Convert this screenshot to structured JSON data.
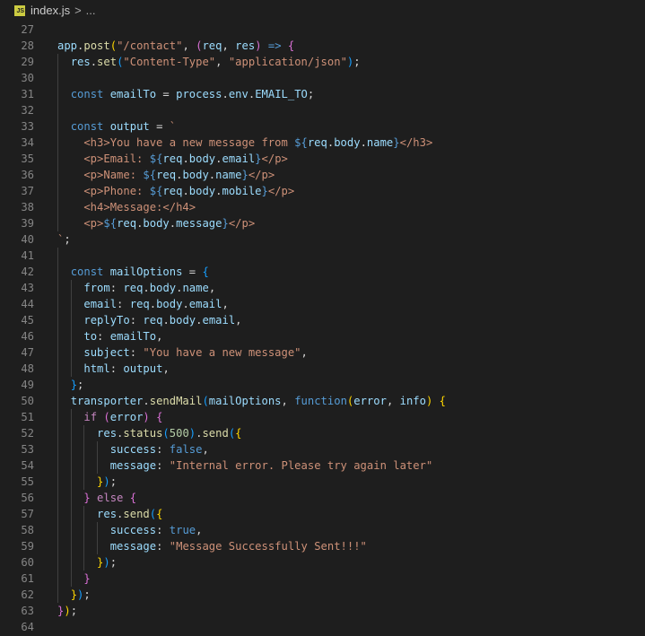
{
  "breadcrumb": {
    "file_icon": "JS",
    "file_name": "index.js",
    "separator": ">",
    "more": "..."
  },
  "colors": {
    "background": "#1e1e1e",
    "line_number": "#858585",
    "variable": "#9cdcfe",
    "function": "#dcdcaa",
    "string": "#ce9178",
    "keyword": "#569cd6",
    "control": "#c586c0",
    "bracket_1": "#ffd700",
    "bracket_2": "#da70d6",
    "bracket_3": "#179fff"
  },
  "lines": [
    {
      "num": "27",
      "tokens": []
    },
    {
      "num": "28",
      "tokens": [
        [
          "v",
          "app"
        ],
        [
          "p",
          "."
        ],
        [
          "f",
          "post"
        ],
        [
          "b1",
          "("
        ],
        [
          "s",
          "\"/contact\""
        ],
        [
          "p",
          ", "
        ],
        [
          "b2",
          "("
        ],
        [
          "v",
          "req"
        ],
        [
          "p",
          ", "
        ],
        [
          "v",
          "res"
        ],
        [
          "b2",
          ")"
        ],
        [
          "p",
          " "
        ],
        [
          "k",
          "=>"
        ],
        [
          "p",
          " "
        ],
        [
          "b2",
          "{"
        ]
      ]
    },
    {
      "num": "29",
      "tokens": [
        [
          "w",
          "  "
        ],
        [
          "v",
          "res"
        ],
        [
          "p",
          "."
        ],
        [
          "f",
          "set"
        ],
        [
          "b3",
          "("
        ],
        [
          "s",
          "\"Content-Type\""
        ],
        [
          "p",
          ", "
        ],
        [
          "s",
          "\"application/json\""
        ],
        [
          "b3",
          ")"
        ],
        [
          "p",
          ";"
        ]
      ]
    },
    {
      "num": "30",
      "tokens": []
    },
    {
      "num": "31",
      "tokens": [
        [
          "w",
          "  "
        ],
        [
          "k",
          "const"
        ],
        [
          "p",
          " "
        ],
        [
          "v",
          "emailTo"
        ],
        [
          "p",
          " = "
        ],
        [
          "v",
          "process"
        ],
        [
          "p",
          "."
        ],
        [
          "v",
          "env"
        ],
        [
          "p",
          "."
        ],
        [
          "v",
          "EMAIL_TO"
        ],
        [
          "p",
          ";"
        ]
      ]
    },
    {
      "num": "32",
      "tokens": []
    },
    {
      "num": "33",
      "tokens": [
        [
          "w",
          "  "
        ],
        [
          "k",
          "const"
        ],
        [
          "p",
          " "
        ],
        [
          "v",
          "output"
        ],
        [
          "p",
          " = "
        ],
        [
          "s",
          "`"
        ]
      ]
    },
    {
      "num": "34",
      "tokens": [
        [
          "s",
          "    <h3>You have a new message from "
        ],
        [
          "k",
          "${"
        ],
        [
          "v",
          "req"
        ],
        [
          "p",
          "."
        ],
        [
          "v",
          "body"
        ],
        [
          "p",
          "."
        ],
        [
          "v",
          "name"
        ],
        [
          "k",
          "}"
        ],
        [
          "s",
          "</h3>"
        ]
      ]
    },
    {
      "num": "35",
      "tokens": [
        [
          "s",
          "    <p>Email: "
        ],
        [
          "k",
          "${"
        ],
        [
          "v",
          "req"
        ],
        [
          "p",
          "."
        ],
        [
          "v",
          "body"
        ],
        [
          "p",
          "."
        ],
        [
          "v",
          "email"
        ],
        [
          "k",
          "}"
        ],
        [
          "s",
          "</p>"
        ]
      ]
    },
    {
      "num": "36",
      "tokens": [
        [
          "s",
          "    <p>Name: "
        ],
        [
          "k",
          "${"
        ],
        [
          "v",
          "req"
        ],
        [
          "p",
          "."
        ],
        [
          "v",
          "body"
        ],
        [
          "p",
          "."
        ],
        [
          "v",
          "name"
        ],
        [
          "k",
          "}"
        ],
        [
          "s",
          "</p>"
        ]
      ]
    },
    {
      "num": "37",
      "tokens": [
        [
          "s",
          "    <p>Phone: "
        ],
        [
          "k",
          "${"
        ],
        [
          "v",
          "req"
        ],
        [
          "p",
          "."
        ],
        [
          "v",
          "body"
        ],
        [
          "p",
          "."
        ],
        [
          "v",
          "mobile"
        ],
        [
          "k",
          "}"
        ],
        [
          "s",
          "</p>"
        ]
      ]
    },
    {
      "num": "38",
      "tokens": [
        [
          "s",
          "    <h4>Message:</h4>"
        ]
      ]
    },
    {
      "num": "39",
      "tokens": [
        [
          "s",
          "    <p>"
        ],
        [
          "k",
          "${"
        ],
        [
          "v",
          "req"
        ],
        [
          "p",
          "."
        ],
        [
          "v",
          "body"
        ],
        [
          "p",
          "."
        ],
        [
          "v",
          "message"
        ],
        [
          "k",
          "}"
        ],
        [
          "s",
          "</p>"
        ]
      ]
    },
    {
      "num": "40",
      "tokens": [
        [
          "s",
          "`"
        ],
        [
          "p",
          ";"
        ]
      ]
    },
    {
      "num": "41",
      "tokens": []
    },
    {
      "num": "42",
      "tokens": [
        [
          "w",
          "  "
        ],
        [
          "k",
          "const"
        ],
        [
          "p",
          " "
        ],
        [
          "v",
          "mailOptions"
        ],
        [
          "p",
          " = "
        ],
        [
          "b3",
          "{"
        ]
      ]
    },
    {
      "num": "43",
      "tokens": [
        [
          "w",
          "    "
        ],
        [
          "v",
          "from"
        ],
        [
          "p",
          ": "
        ],
        [
          "v",
          "req"
        ],
        [
          "p",
          "."
        ],
        [
          "v",
          "body"
        ],
        [
          "p",
          "."
        ],
        [
          "v",
          "name"
        ],
        [
          "p",
          ","
        ]
      ]
    },
    {
      "num": "44",
      "tokens": [
        [
          "w",
          "    "
        ],
        [
          "v",
          "email"
        ],
        [
          "p",
          ": "
        ],
        [
          "v",
          "req"
        ],
        [
          "p",
          "."
        ],
        [
          "v",
          "body"
        ],
        [
          "p",
          "."
        ],
        [
          "v",
          "email"
        ],
        [
          "p",
          ","
        ]
      ]
    },
    {
      "num": "45",
      "tokens": [
        [
          "w",
          "    "
        ],
        [
          "v",
          "replyTo"
        ],
        [
          "p",
          ": "
        ],
        [
          "v",
          "req"
        ],
        [
          "p",
          "."
        ],
        [
          "v",
          "body"
        ],
        [
          "p",
          "."
        ],
        [
          "v",
          "email"
        ],
        [
          "p",
          ","
        ]
      ]
    },
    {
      "num": "46",
      "tokens": [
        [
          "w",
          "    "
        ],
        [
          "v",
          "to"
        ],
        [
          "p",
          ": "
        ],
        [
          "v",
          "emailTo"
        ],
        [
          "p",
          ","
        ]
      ]
    },
    {
      "num": "47",
      "tokens": [
        [
          "w",
          "    "
        ],
        [
          "v",
          "subject"
        ],
        [
          "p",
          ": "
        ],
        [
          "s",
          "\"You have a new message\""
        ],
        [
          "p",
          ","
        ]
      ]
    },
    {
      "num": "48",
      "tokens": [
        [
          "w",
          "    "
        ],
        [
          "v",
          "html"
        ],
        [
          "p",
          ": "
        ],
        [
          "v",
          "output"
        ],
        [
          "p",
          ","
        ]
      ]
    },
    {
      "num": "49",
      "tokens": [
        [
          "w",
          "  "
        ],
        [
          "b3",
          "}"
        ],
        [
          "p",
          ";"
        ]
      ]
    },
    {
      "num": "50",
      "tokens": [
        [
          "w",
          "  "
        ],
        [
          "v",
          "transporter"
        ],
        [
          "p",
          "."
        ],
        [
          "f",
          "sendMail"
        ],
        [
          "b3",
          "("
        ],
        [
          "v",
          "mailOptions"
        ],
        [
          "p",
          ", "
        ],
        [
          "k",
          "function"
        ],
        [
          "b1",
          "("
        ],
        [
          "v",
          "error"
        ],
        [
          "p",
          ", "
        ],
        [
          "v",
          "info"
        ],
        [
          "b1",
          ")"
        ],
        [
          "p",
          " "
        ],
        [
          "b1",
          "{"
        ]
      ]
    },
    {
      "num": "51",
      "tokens": [
        [
          "w",
          "    "
        ],
        [
          "c",
          "if"
        ],
        [
          "p",
          " "
        ],
        [
          "b2",
          "("
        ],
        [
          "v",
          "error"
        ],
        [
          "b2",
          ")"
        ],
        [
          "p",
          " "
        ],
        [
          "b2",
          "{"
        ]
      ]
    },
    {
      "num": "52",
      "tokens": [
        [
          "w",
          "      "
        ],
        [
          "v",
          "res"
        ],
        [
          "p",
          "."
        ],
        [
          "f",
          "status"
        ],
        [
          "b3",
          "("
        ],
        [
          "n",
          "500"
        ],
        [
          "b3",
          ")"
        ],
        [
          "p",
          "."
        ],
        [
          "f",
          "send"
        ],
        [
          "b3",
          "("
        ],
        [
          "b1",
          "{"
        ]
      ]
    },
    {
      "num": "53",
      "tokens": [
        [
          "w",
          "        "
        ],
        [
          "v",
          "success"
        ],
        [
          "p",
          ": "
        ],
        [
          "k",
          "false"
        ],
        [
          "p",
          ","
        ]
      ]
    },
    {
      "num": "54",
      "tokens": [
        [
          "w",
          "        "
        ],
        [
          "v",
          "message"
        ],
        [
          "p",
          ": "
        ],
        [
          "s",
          "\"Internal error. Please try again later\""
        ]
      ]
    },
    {
      "num": "55",
      "tokens": [
        [
          "w",
          "      "
        ],
        [
          "b1",
          "}"
        ],
        [
          "b3",
          ")"
        ],
        [
          "p",
          ";"
        ]
      ]
    },
    {
      "num": "56",
      "tokens": [
        [
          "w",
          "    "
        ],
        [
          "b2",
          "}"
        ],
        [
          "p",
          " "
        ],
        [
          "c",
          "else"
        ],
        [
          "p",
          " "
        ],
        [
          "b2",
          "{"
        ]
      ]
    },
    {
      "num": "57",
      "tokens": [
        [
          "w",
          "      "
        ],
        [
          "v",
          "res"
        ],
        [
          "p",
          "."
        ],
        [
          "f",
          "send"
        ],
        [
          "b3",
          "("
        ],
        [
          "b1",
          "{"
        ]
      ]
    },
    {
      "num": "58",
      "tokens": [
        [
          "w",
          "        "
        ],
        [
          "v",
          "success"
        ],
        [
          "p",
          ": "
        ],
        [
          "k",
          "true"
        ],
        [
          "p",
          ","
        ]
      ]
    },
    {
      "num": "59",
      "tokens": [
        [
          "w",
          "        "
        ],
        [
          "v",
          "message"
        ],
        [
          "p",
          ": "
        ],
        [
          "s",
          "\"Message Successfully Sent!!!\""
        ]
      ]
    },
    {
      "num": "60",
      "tokens": [
        [
          "w",
          "      "
        ],
        [
          "b1",
          "}"
        ],
        [
          "b3",
          ")"
        ],
        [
          "p",
          ";"
        ]
      ]
    },
    {
      "num": "61",
      "tokens": [
        [
          "w",
          "    "
        ],
        [
          "b2",
          "}"
        ]
      ]
    },
    {
      "num": "62",
      "tokens": [
        [
          "w",
          "  "
        ],
        [
          "b1",
          "}"
        ],
        [
          "b3",
          ")"
        ],
        [
          "p",
          ";"
        ]
      ]
    },
    {
      "num": "63",
      "tokens": [
        [
          "b2",
          "}"
        ],
        [
          "b1",
          ")"
        ],
        [
          "p",
          ";"
        ]
      ]
    },
    {
      "num": "64",
      "tokens": []
    }
  ]
}
